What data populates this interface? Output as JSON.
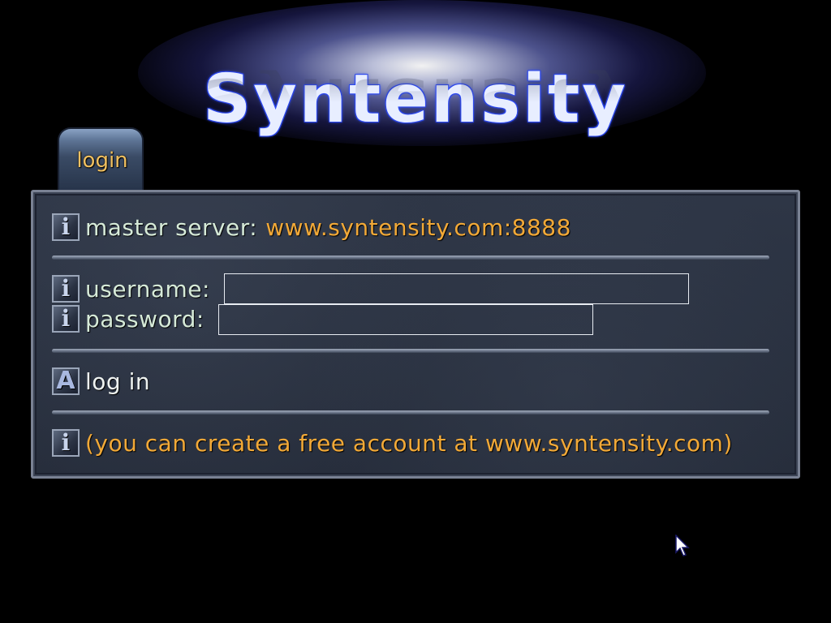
{
  "logo": {
    "text": "Syntensity"
  },
  "tab": {
    "label": "login"
  },
  "icons": {
    "info": "i",
    "action": "A"
  },
  "master_server": {
    "label": "master server:",
    "value": "www.syntensity.com:8888"
  },
  "username": {
    "label": "username:",
    "value": ""
  },
  "password": {
    "label": "password:",
    "value": ""
  },
  "login_action": {
    "label": "log in"
  },
  "note": {
    "text": "(you can create a free account at www.syntensity.com)"
  },
  "colors": {
    "accent_orange": "#f2a937",
    "label_text": "#d6ead8",
    "panel_bg": "#2a3240",
    "logo_glow": "#3050ff"
  }
}
